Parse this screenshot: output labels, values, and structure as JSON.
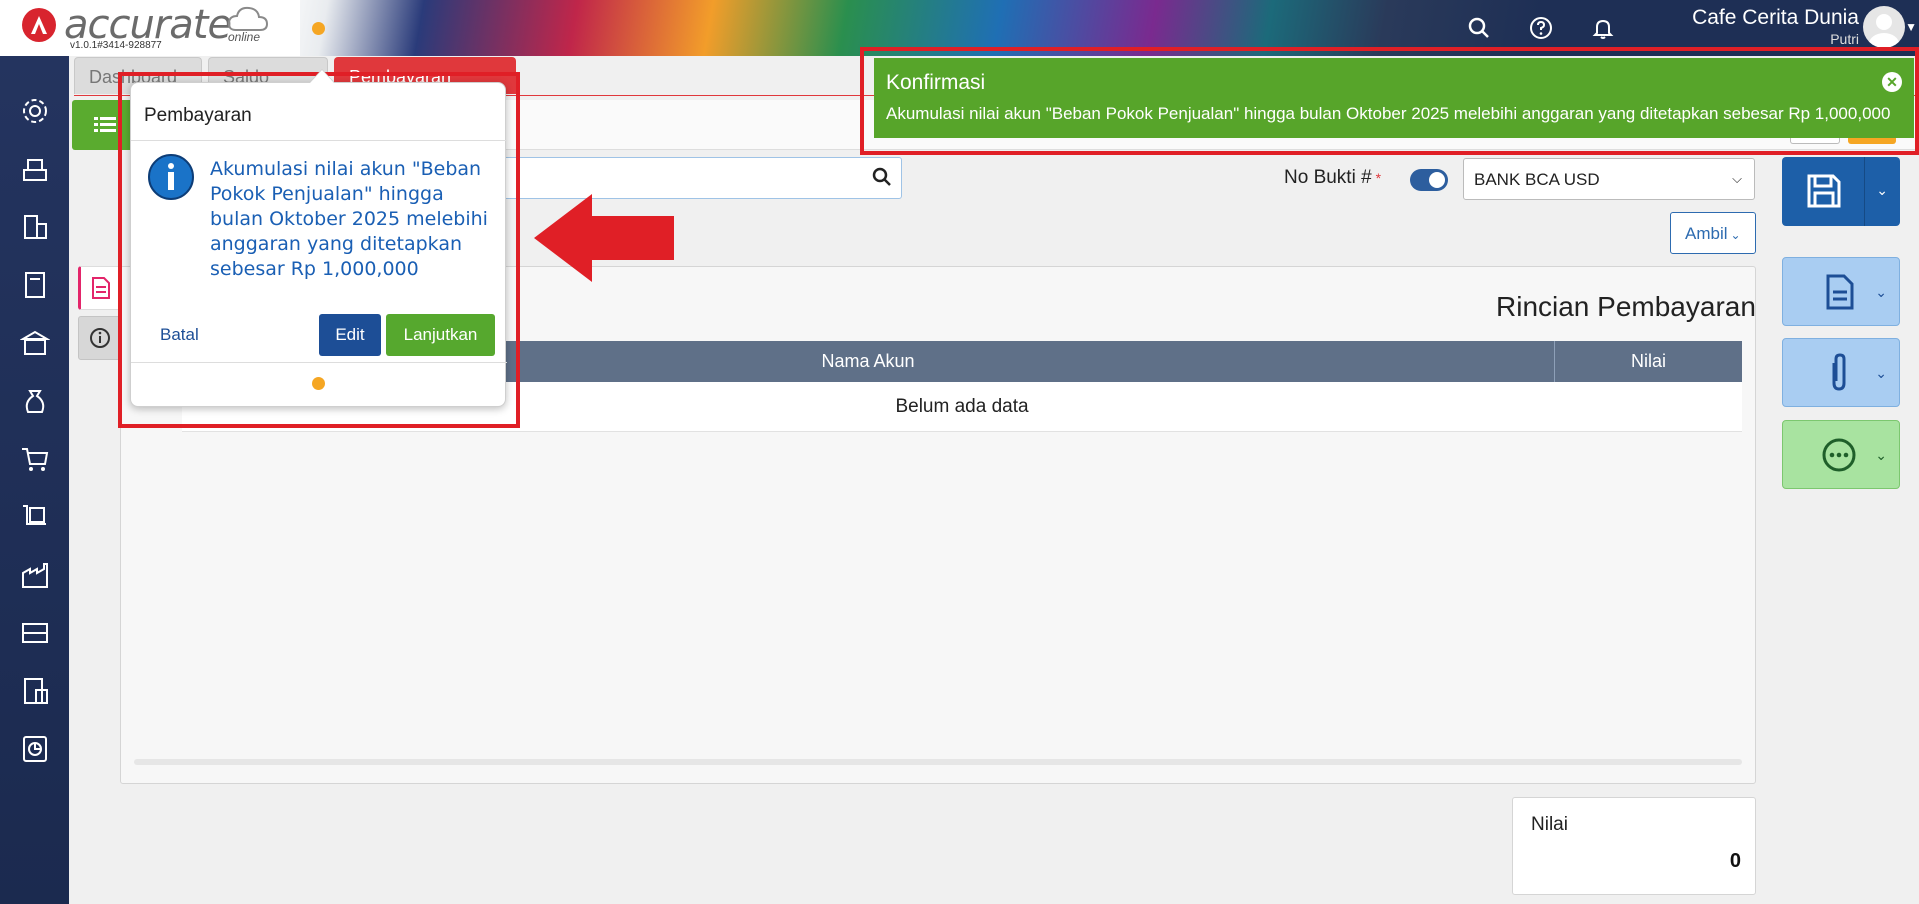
{
  "header": {
    "logo_text": "accurate",
    "logo_sub": "online",
    "version": "v1.0.1#3414-928877",
    "company": "Cafe Cerita Dunia",
    "user": "Putri"
  },
  "tabs": [
    {
      "label": "Dashboard"
    },
    {
      "label": "Saldo"
    },
    {
      "label": "Pembayaran"
    }
  ],
  "form": {
    "no_bukti_label": "No Bukti #",
    "required_mark": "*",
    "bank_value": "BANK BCA USD",
    "ambil_label": "Ambil"
  },
  "details": {
    "title": "Rincian Pembayaran",
    "columns": [
      "Nama Akun",
      "Nilai"
    ],
    "empty_text": "Belum ada data"
  },
  "total": {
    "label": "Nilai",
    "value": "0"
  },
  "popup": {
    "title": "Pembayaran",
    "message": "Akumulasi nilai akun \"Beban Pokok Penjualan\" hingga bulan Oktober 2025 melebihi anggaran yang ditetapkan sebesar Rp 1,000,000",
    "batal_label": "Batal",
    "edit_label": "Edit",
    "lanjutkan_label": "Lanjutkan"
  },
  "toast": {
    "title": "Konfirmasi",
    "message": "Akumulasi nilai akun \"Beban Pokok Penjualan\" hingga bulan Oktober 2025 melebihi anggaran yang ditetapkan sebesar Rp 1,000,000"
  },
  "colors": {
    "accent_red": "#e0383c",
    "primary_blue": "#1d5fa8",
    "success_green": "#57a52a",
    "sidebar": "#24345f"
  }
}
